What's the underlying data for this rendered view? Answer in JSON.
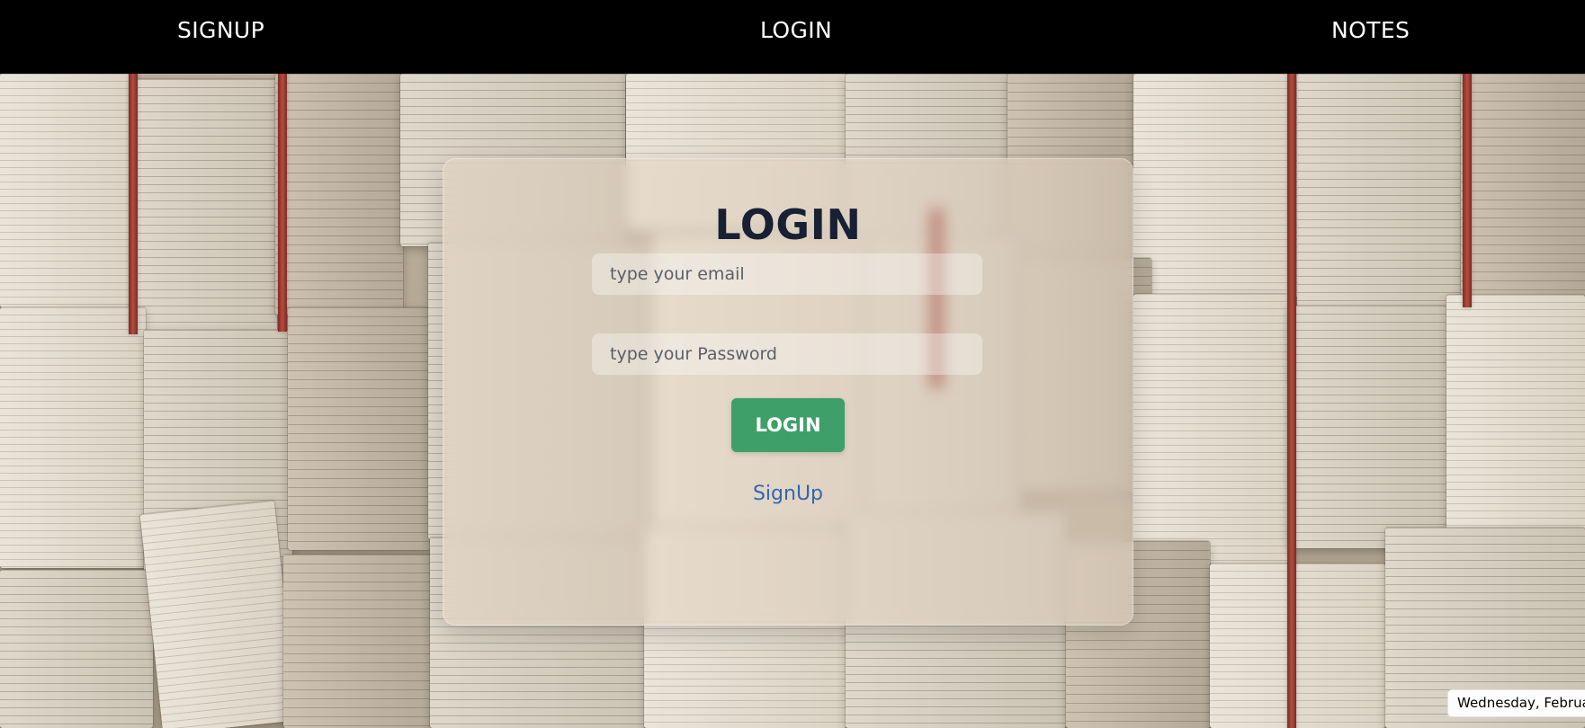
{
  "nav": {
    "items": [
      {
        "label": "SIGNUP"
      },
      {
        "label": "LOGIN"
      },
      {
        "label": "NOTES"
      }
    ]
  },
  "login": {
    "title": "LOGIN",
    "email_placeholder": "type your email",
    "password_placeholder": "type your Password",
    "button_label": "LOGIN",
    "signup_link": "SignUp"
  },
  "status": {
    "date_label": "Wednesday, February"
  },
  "colors": {
    "nav_background": "#000000",
    "login_button": "#3f9f68",
    "signup_link": "#2f67b1",
    "card_text": "#182034"
  }
}
